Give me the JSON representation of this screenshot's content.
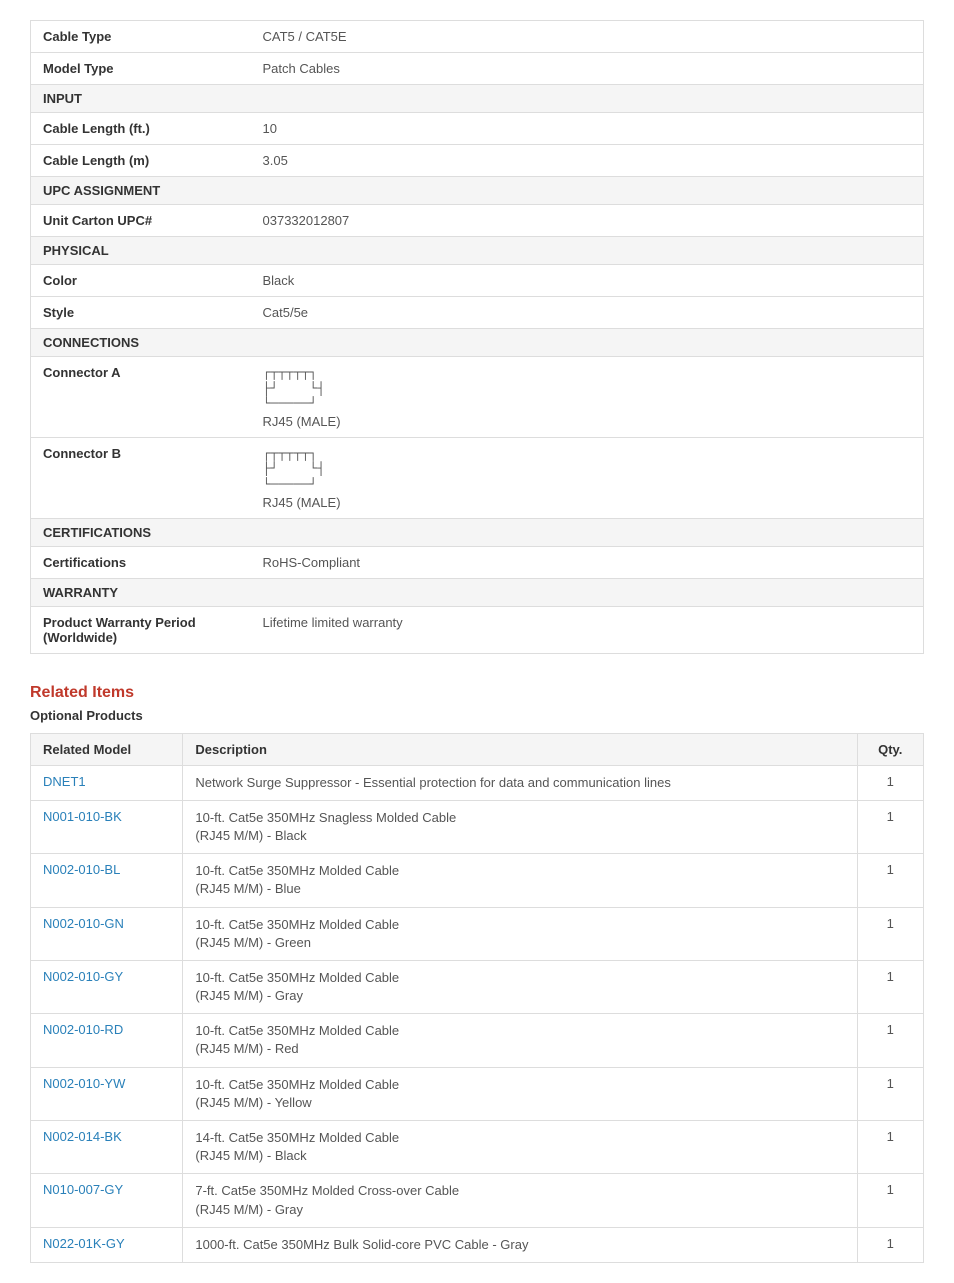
{
  "specs": {
    "rows": [
      {
        "type": "row",
        "label": "Cable Type",
        "value": "CAT5 / CAT5E"
      },
      {
        "type": "row",
        "label": "Model Type",
        "value": "Patch Cables"
      },
      {
        "type": "section",
        "label": "INPUT"
      },
      {
        "type": "row",
        "label": "Cable Length (ft.)",
        "value": "10"
      },
      {
        "type": "row",
        "label": "Cable Length (m)",
        "value": "3.05"
      },
      {
        "type": "section",
        "label": "UPC ASSIGNMENT"
      },
      {
        "type": "row",
        "label": "Unit Carton UPC#",
        "value": "037332012807"
      },
      {
        "type": "section",
        "label": "PHYSICAL"
      },
      {
        "type": "row",
        "label": "Color",
        "value": "Black"
      },
      {
        "type": "row",
        "label": "Style",
        "value": "Cat5/5e"
      },
      {
        "type": "section",
        "label": "CONNECTIONS"
      },
      {
        "type": "connector",
        "label": "Connector A",
        "value": "RJ45 (MALE)"
      },
      {
        "type": "connector",
        "label": "Connector B",
        "value": "RJ45 (MALE)"
      },
      {
        "type": "section",
        "label": "CERTIFICATIONS"
      },
      {
        "type": "row",
        "label": "Certifications",
        "value": "RoHS-Compliant"
      },
      {
        "type": "section",
        "label": "WARRANTY"
      },
      {
        "type": "row",
        "label": "Product Warranty Period (Worldwide)",
        "value": "Lifetime limited warranty"
      }
    ]
  },
  "related_items": {
    "title": "Related Items",
    "optional_label": "Optional Products",
    "columns": [
      "Related Model",
      "Description",
      "Qty."
    ],
    "rows": [
      {
        "model": "DNET1",
        "description": "Network Surge Suppressor - Essential protection for data and communication lines",
        "qty": "1"
      },
      {
        "model": "N001-010-BK",
        "description": "10-ft. Cat5e 350MHz Snagless Molded Cable\n(RJ45 M/M) - Black",
        "qty": "1"
      },
      {
        "model": "N002-010-BL",
        "description": "10-ft. Cat5e 350MHz Molded Cable\n(RJ45 M/M) - Blue",
        "qty": "1"
      },
      {
        "model": "N002-010-GN",
        "description": "10-ft. Cat5e 350MHz Molded Cable\n(RJ45 M/M) - Green",
        "qty": "1"
      },
      {
        "model": "N002-010-GY",
        "description": "10-ft. Cat5e 350MHz Molded Cable\n(RJ45 M/M) - Gray",
        "qty": "1"
      },
      {
        "model": "N002-010-RD",
        "description": "10-ft. Cat5e 350MHz Molded Cable\n(RJ45 M/M) - Red",
        "qty": "1"
      },
      {
        "model": "N002-010-YW",
        "description": "10-ft. Cat5e 350MHz Molded Cable\n(RJ45 M/M) - Yellow",
        "qty": "1"
      },
      {
        "model": "N002-014-BK",
        "description": "14-ft. Cat5e 350MHz Molded Cable\n(RJ45 M/M) - Black",
        "qty": "1"
      },
      {
        "model": "N010-007-GY",
        "description": "7-ft. Cat5e 350MHz Molded Cross-over Cable\n(RJ45 M/M) - Gray",
        "qty": "1"
      },
      {
        "model": "N022-01K-GY",
        "description": "1000-ft. Cat5e 350MHz Bulk Solid-core PVC Cable - Gray",
        "qty": "1"
      }
    ]
  }
}
